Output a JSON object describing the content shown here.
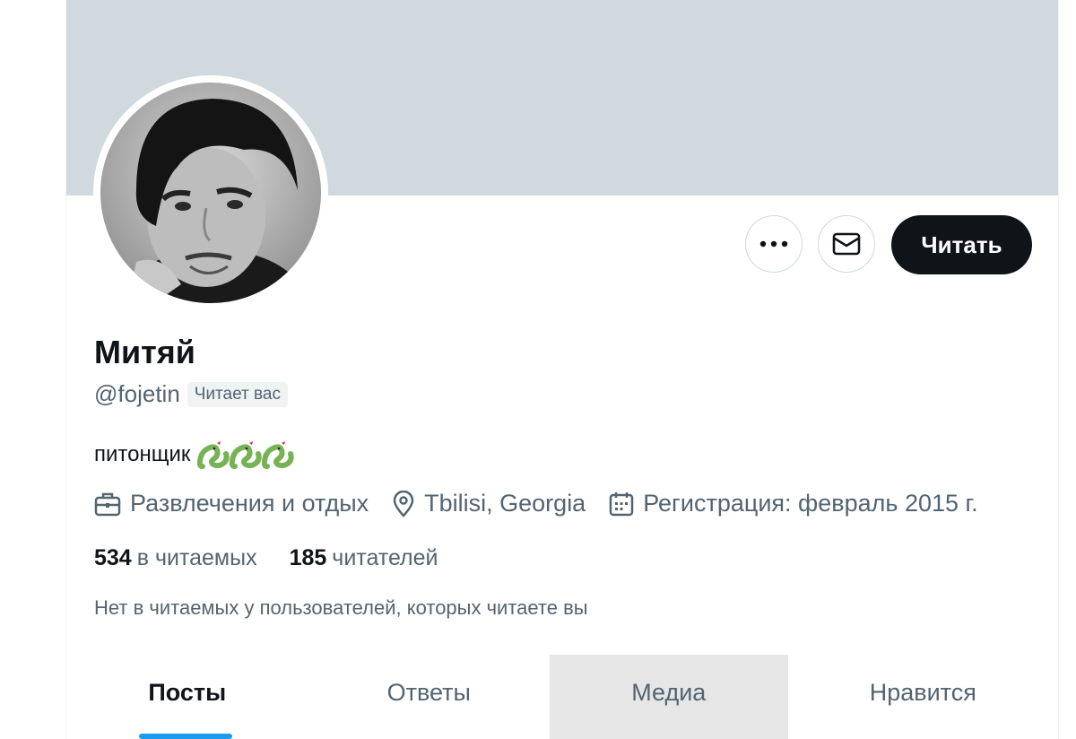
{
  "profile": {
    "name": "Митяй",
    "handle": "@fojetin",
    "follows_you_badge": "Читает вас",
    "bio": "питонщик",
    "bio_emoji": "snake-emoji",
    "bio_emoji_count": 3,
    "category": "Развлечения и отдых",
    "location": "Tbilisi, Georgia",
    "joined": "Регистрация: февраль 2015 г.",
    "following_count": "534",
    "following_label": "в читаемых",
    "followers_count": "185",
    "followers_label": "читателей",
    "mutual_note": "Нет в читаемых у пользователей, которых читаете вы"
  },
  "actions": {
    "more_icon": "ellipsis-icon",
    "message_icon": "envelope-icon",
    "follow_label": "Читать"
  },
  "tabs": [
    {
      "label": "Посты",
      "active": true
    },
    {
      "label": "Ответы",
      "active": false
    },
    {
      "label": "Медиа",
      "active": false,
      "hovered": true
    },
    {
      "label": "Нравится",
      "active": false
    }
  ],
  "colors": {
    "banner": "#cfd9de",
    "accent": "#1d9bf0",
    "primary_text": "#0f1419",
    "secondary_text": "#536471",
    "follow_button_bg": "#0f1419"
  }
}
